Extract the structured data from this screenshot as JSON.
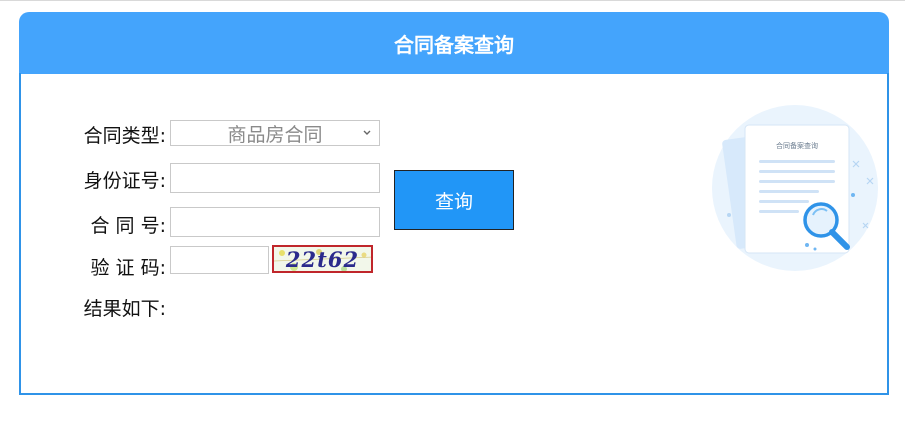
{
  "header": {
    "title": "合同备案查询"
  },
  "form": {
    "contract_type_label": "合同类型:",
    "contract_type_selected": "商品房合同",
    "id_number_label": "身份证号:",
    "id_number_value": "",
    "contract_no_label": "合 同 号:",
    "contract_no_value": "",
    "captcha_label": "验 证 码:",
    "captcha_value": "",
    "captcha_image_text": "22t62",
    "result_label": "结果如下:"
  },
  "actions": {
    "query_label": "查询"
  },
  "illustration": {
    "doc_title": "合同备案查询",
    "icon": "magnifier-document-icon"
  },
  "colors": {
    "header_bg": "#44a4fc",
    "border": "#2f93e8",
    "button_bg": "#2196f7",
    "captcha_border": "#c0262b"
  }
}
